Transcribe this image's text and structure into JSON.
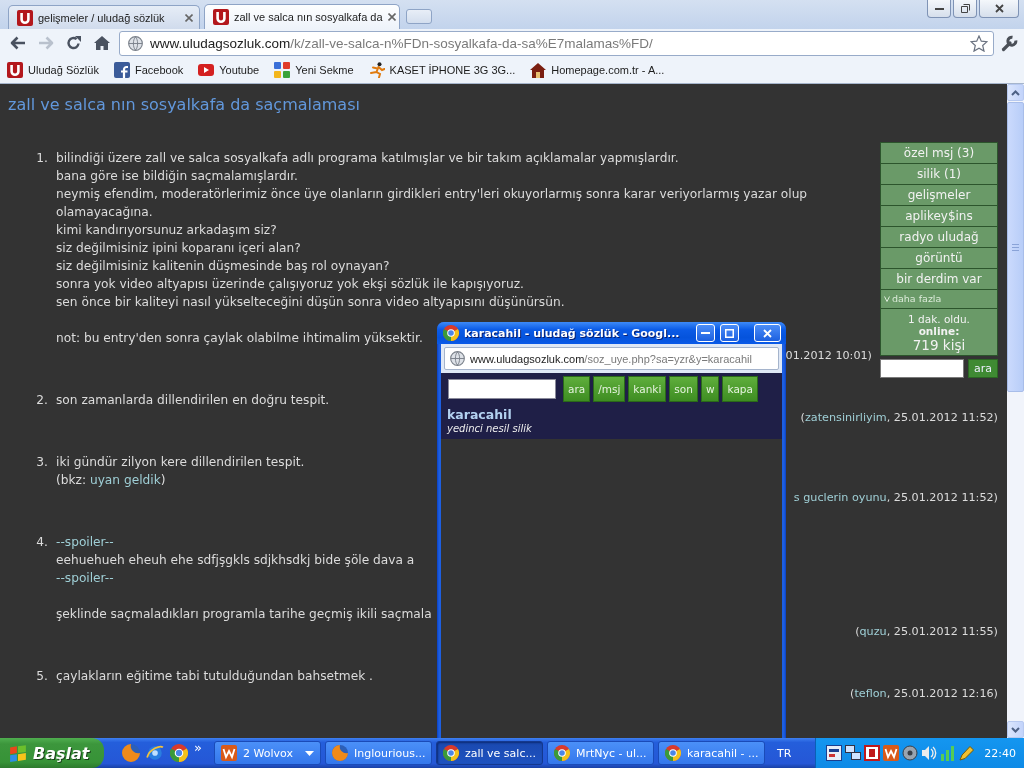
{
  "browser": {
    "tabs": [
      {
        "title": "gelişmeler / uludağ sözlük",
        "selected": false
      },
      {
        "title": "zall ve salca nın sosyalkafa da",
        "selected": true
      }
    ],
    "nav_buttons": [
      {
        "kind": "back",
        "disabled": false
      },
      {
        "kind": "forward",
        "disabled": true
      },
      {
        "kind": "reload",
        "disabled": false
      },
      {
        "kind": "home",
        "disabled": false
      }
    ],
    "address": {
      "host": "www.uludagsozluk.com",
      "path": "/k/zall-ve-salca-n%FDn-sosyalkafa-da-sa%E7malamas%FD/"
    },
    "bookmarks": [
      "Uludağ Sözlük",
      "Facebook",
      "Youtube",
      "Yeni Sekme",
      "KASET İPHONE 3G 3G...",
      "Homepage.com.tr - A..."
    ]
  },
  "page": {
    "title": "zall ve salca nın sosyalkafa da saçmalaması",
    "menu": [
      {
        "label": "özel msj (3)",
        "kind": "link"
      },
      {
        "label": "silik (1)",
        "kind": "link"
      },
      {
        "label": "gelişmeler",
        "kind": "link"
      },
      {
        "label": "aplikey$ins",
        "kind": "link"
      },
      {
        "label": "radyo uludağ",
        "kind": "link"
      },
      {
        "label": "görüntü",
        "kind": "link"
      },
      {
        "label": "bir derdim var",
        "kind": "link"
      },
      {
        "label": "daha fazla",
        "kind": "more"
      }
    ],
    "online": {
      "ago": "1 dak. oldu.",
      "label": "online:",
      "count": "719 kişi"
    },
    "search": {
      "button": "ara"
    },
    "entries": [
      {
        "number": "1.",
        "paragraphs": [
          [
            "bilindiği üzere zall ve salca sosyalkafa adlı programa katılmışlar ve bir takım açıklamalar yapmışlardır.",
            "bana göre ise bildiğin saçmalamışlardır.",
            "neymiş efendim, moderatörlerimiz önce üye olanların girdikleri entry'leri okuyorlarmış sonra karar veriyorlarmış yazar olup olamayacağına.",
            "kimi kandırıyorsunuz arkadaşım siz?",
            "siz değilmisiniz ipini koparanı içeri alan?",
            "siz değilmisiniz kalitenin düşmesinde baş rol oynayan?",
            "sonra yok video altyapısı üzerinde çalışıyoruz yok ekşi sözlük ile kapışıyoruz.",
            "sen önce bir kaliteyi nasıl yükselteceğini düşün sonra video altyapısını düşünürsün."
          ],
          [
            "not: bu entry'den sonra çaylak olabilme ihtimalim yüksektir."
          ]
        ],
        "signature": [
          {
            "kind": "text",
            "text": "01.2012 10:01)"
          }
        ]
      },
      {
        "number": "2.",
        "paragraphs": [
          [
            "son zamanlarda dillendirilen en doğru tespit."
          ]
        ],
        "signature": [
          {
            "kind": "text",
            "text": "("
          },
          {
            "kind": "link",
            "text": "zatensinirliyim"
          },
          {
            "kind": "text",
            "text": ", 25.01.2012 11:52)"
          }
        ]
      },
      {
        "number": "3.",
        "paragraphs": [
          [
            "iki gündür zilyon kere dillendirilen tespit.",
            [
              {
                "kind": "text",
                "text": "(bkz: "
              },
              {
                "kind": "link",
                "text": "uyan geldik"
              },
              {
                "kind": "text",
                "text": ")"
              }
            ]
          ]
        ],
        "signature": [
          {
            "kind": "link",
            "text": "s guclerin oyunu"
          },
          {
            "kind": "text",
            "text": ", 25.01.2012 11:52)"
          }
        ]
      },
      {
        "number": "4.",
        "paragraphs": [
          [
            [
              {
                "kind": "link",
                "text": "--spoiler--"
              }
            ],
            "eehuehueh eheuh ehe sdfjşgkls sdjkhsdkj bide şöle dava a",
            [
              {
                "kind": "link",
                "text": "--spoiler--"
              }
            ]
          ],
          [
            "şeklinde saçmaladıkları programla tarihe geçmiş ikili saçmala"
          ]
        ],
        "signature": [
          {
            "kind": "text",
            "text": "("
          },
          {
            "kind": "link",
            "text": "quzu"
          },
          {
            "kind": "text",
            "text": ", 25.01.2012 11:55)"
          }
        ]
      },
      {
        "number": "5.",
        "paragraphs": [
          [
            "çaylakların eğitime tabi tutulduğundan bahsetmek ."
          ]
        ],
        "signature": [
          {
            "kind": "text",
            "text": "("
          },
          {
            "kind": "link",
            "text": "teflon"
          },
          {
            "kind": "text",
            "text": ", 25.01.2012 12:16)"
          }
        ]
      }
    ]
  },
  "popup": {
    "title": "karacahil - uludağ sözlük - Googl...",
    "address": {
      "host": "www.uludagsozluk.com",
      "path": "/soz_uye.php?sa=yzr&y=karacahil"
    },
    "buttons": [
      "ara",
      "/msj",
      "kanki",
      "son",
      "w",
      "kapa"
    ],
    "username": "karacahil",
    "rank": "yedinci nesil silik"
  },
  "taskbar": {
    "start": "Başlat",
    "overflow": "»",
    "tasks": [
      {
        "label": "2 Wolvox",
        "grouped": true,
        "selected": false
      },
      {
        "label": "Inglourious...",
        "grouped": false,
        "selected": false
      },
      {
        "label": "zall ve salc...",
        "grouped": false,
        "selected": true
      },
      {
        "label": "MrtNyc - ul...",
        "grouped": false,
        "selected": false
      },
      {
        "label": "karacahil - ...",
        "grouped": false,
        "selected": false
      }
    ],
    "language": "TR",
    "clock": "22:40"
  }
}
